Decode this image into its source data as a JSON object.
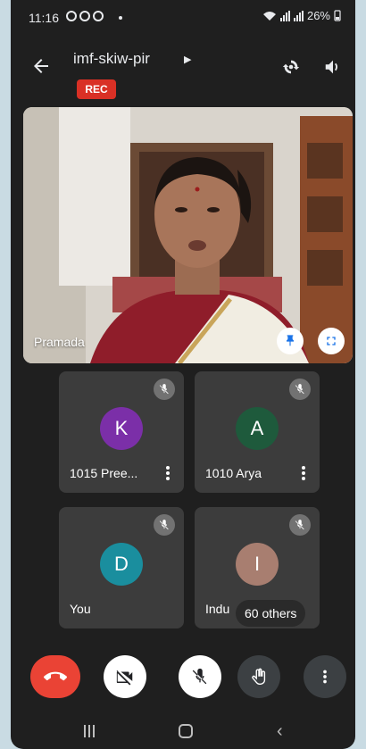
{
  "status_bar": {
    "time": "11:16",
    "battery": "26%"
  },
  "header": {
    "meeting_code": "imf-skiw-pir",
    "rec_badge": "REC"
  },
  "main_video": {
    "participant_name": "Pramada"
  },
  "tiles": [
    {
      "name": "1015 Pree...",
      "initial": "K",
      "avatar_color": "#7b2fa8"
    },
    {
      "name": "1010 Arya",
      "initial": "A",
      "avatar_color": "#1e5a3c"
    },
    {
      "name": "You",
      "initial": "D",
      "avatar_color": "#1a8e9e"
    },
    {
      "name": "Indu",
      "initial": "I",
      "avatar_color": "#a87e70"
    }
  ],
  "others_badge": "60 others",
  "colors": {
    "end_call": "#ea4335",
    "rec": "#d93025",
    "background": "#1f1f1f"
  }
}
